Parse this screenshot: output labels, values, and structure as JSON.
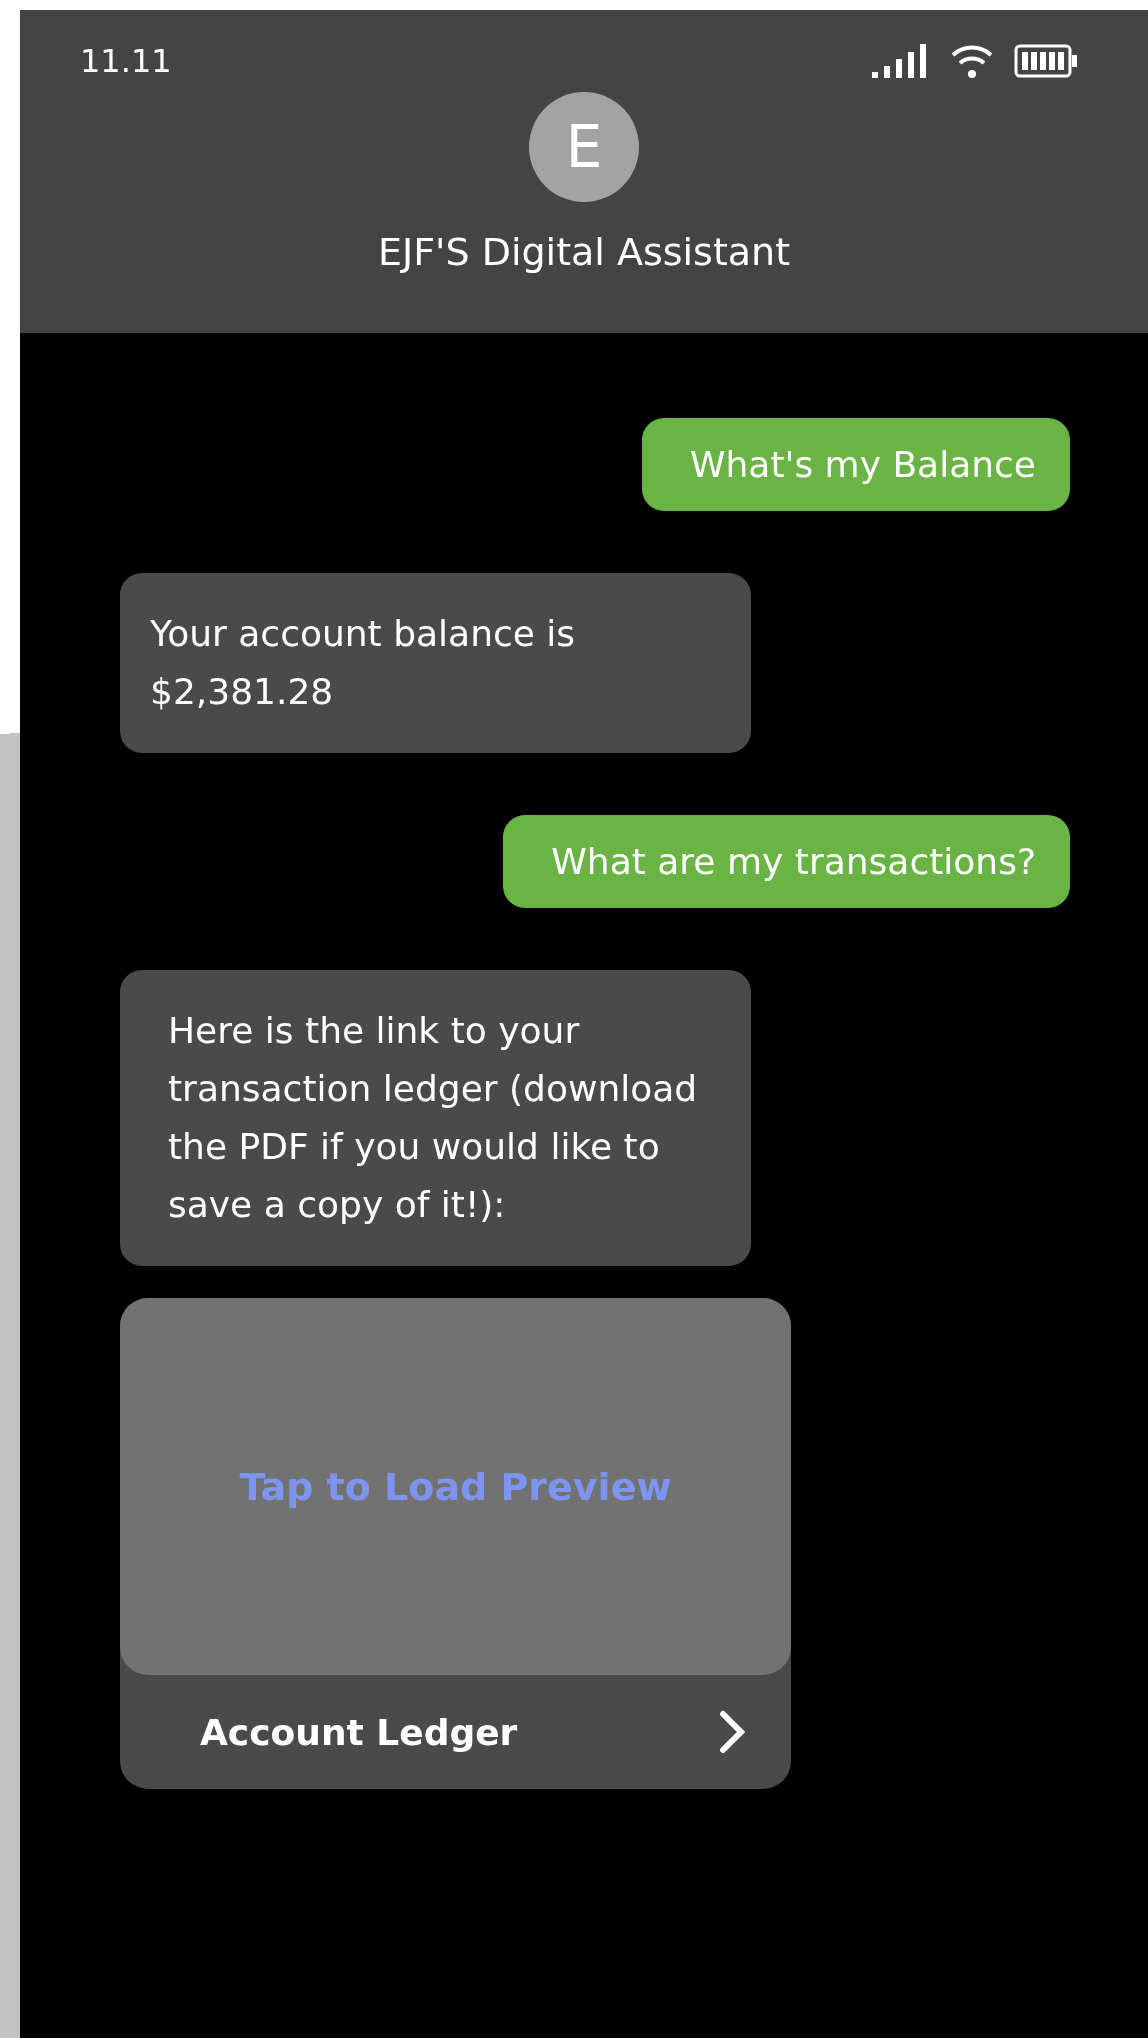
{
  "status_bar": {
    "time": "11.11"
  },
  "header": {
    "avatar_letter": "E",
    "title": "EJF'S Digital Assistant"
  },
  "messages": [
    {
      "kind": "user",
      "text": "What's my Balance"
    },
    {
      "kind": "bot",
      "text": "Your account balance is $2,381.28"
    },
    {
      "kind": "user",
      "text": "What are my transactions?"
    },
    {
      "kind": "bot",
      "text": "Here is the link to your transaction ledger (download the PDF if you would like to save a copy of it!):"
    },
    {
      "kind": "attachment",
      "preview_label": "Tap to Load Preview",
      "title": "Account Ledger"
    }
  ]
}
